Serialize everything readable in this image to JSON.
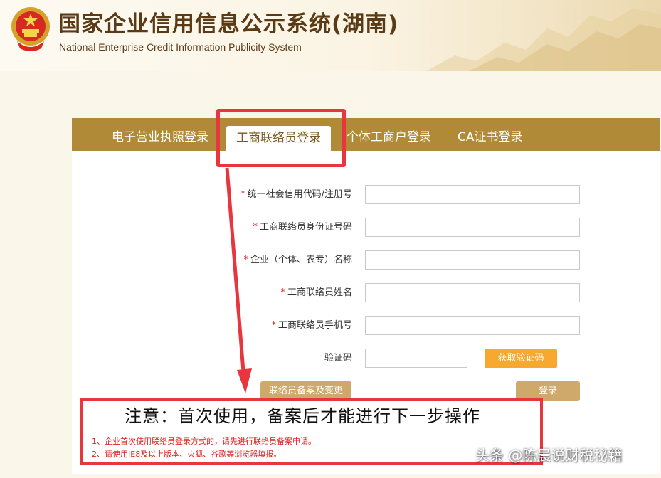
{
  "header": {
    "title_cn": "国家企业信用信息公示系统(湖南)",
    "title_en": "National Enterprise Credit Information Publicity System",
    "emblem_icon": "national-emblem-icon"
  },
  "tabs": [
    {
      "label": "电子营业执照登录",
      "active": false
    },
    {
      "label": "工商联络员登录",
      "active": true
    },
    {
      "label": "个体工商户登录",
      "active": false
    },
    {
      "label": "CA证书登录",
      "active": false
    }
  ],
  "form": {
    "required_mark": "*",
    "fields": [
      {
        "label": "统一社会信用代码/注册号",
        "value": "",
        "required": true
      },
      {
        "label": "工商联络员身份证号码",
        "value": "",
        "required": true
      },
      {
        "label": "企业（个体、农专）名称",
        "value": "",
        "required": true
      },
      {
        "label": "工商联络员姓名",
        "value": "",
        "required": true
      },
      {
        "label": "工商联络员手机号",
        "value": "",
        "required": true
      }
    ],
    "captcha_label": "验证码",
    "captcha_value": "",
    "get_captcha_label": "获取验证码",
    "register_label": "联络员备案及变更",
    "login_label": "登录"
  },
  "notice": {
    "title": "注意：首次使用，备案后才能进行下一步操作",
    "lines": [
      "1、企业首次使用联络员登录方式的，请先进行联络员备案申请。",
      "2、请使用IE8及以上版本、火狐、谷歌等浏览器填报。"
    ]
  },
  "watermark": "头条 @陈晨说财税秘籍",
  "colors": {
    "tab_bar": "#b08a36",
    "orange_button": "#f7a82f",
    "tan_button": "#cfa96b",
    "annotation_red": "#e8363f",
    "required_red": "#e02020",
    "brand_brown": "#5b3a16"
  }
}
